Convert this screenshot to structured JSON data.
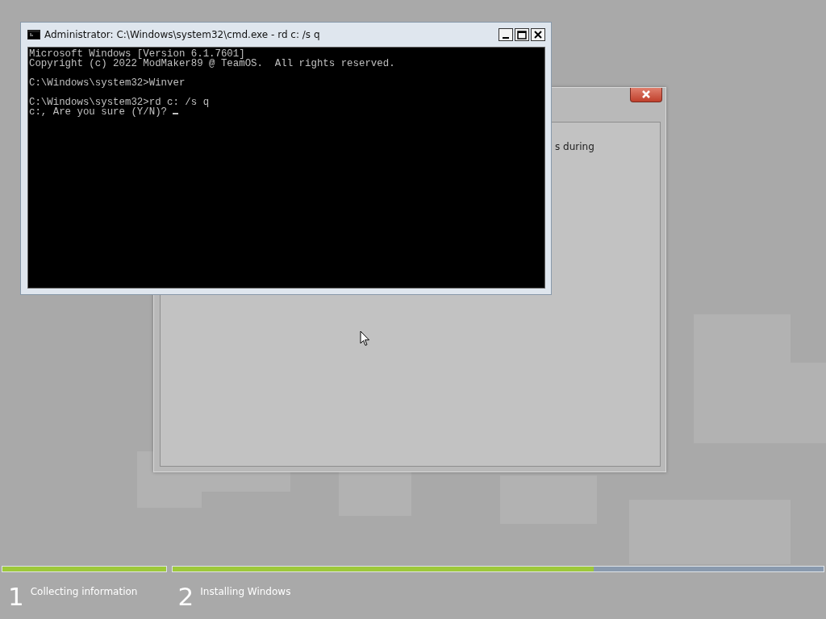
{
  "setup_dialog": {
    "visible_text": "s during"
  },
  "console_window": {
    "title": "Administrator: C:\\Windows\\system32\\cmd.exe - rd  c: /s q",
    "blocks": [
      [
        "Microsoft Windows [Version 6.1.7601]",
        "Copyright (c) 2022 ModMaker89 @ TeamOS.  All rights reserved."
      ],
      [
        "C:\\Windows\\system32>Winver"
      ],
      [
        "C:\\Windows\\system32>rd c: /s q",
        "c:, Are you sure (Y/N)?"
      ]
    ]
  },
  "steps": [
    {
      "number": "1",
      "label": "Collecting information",
      "level": 1
    },
    {
      "number": "2",
      "label": "Installing Windows",
      "level": 0.647
    }
  ]
}
